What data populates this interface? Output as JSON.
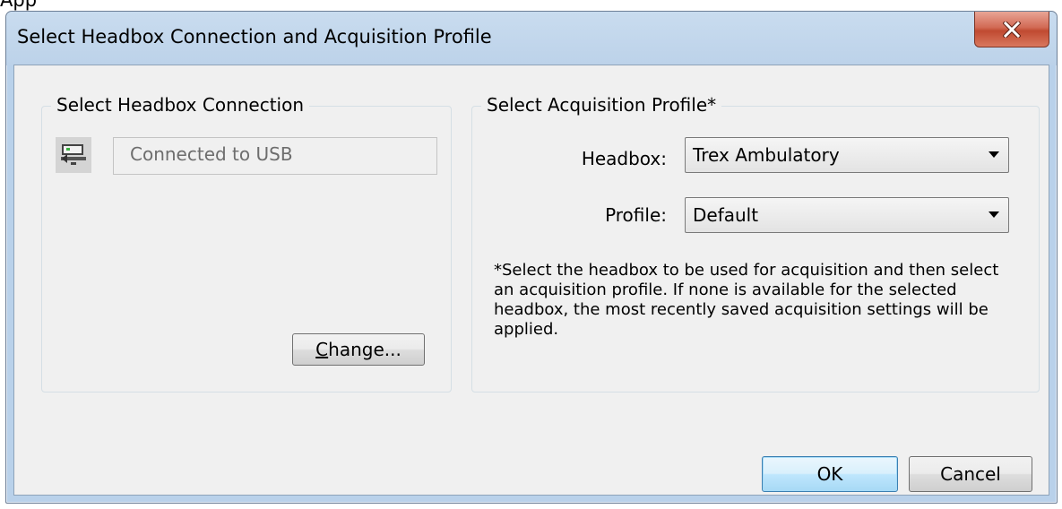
{
  "background_text": "App",
  "window": {
    "title": "Select Headbox Connection and Acquisition Profile",
    "close_icon": "close-icon"
  },
  "connection_group": {
    "legend": "Select Headbox Connection",
    "icon": "usb-connection-icon",
    "status_value": "Connected to USB",
    "change_button": {
      "prefix": "",
      "mnemonic": "C",
      "rest": "hange..."
    }
  },
  "profile_group": {
    "legend": "Select Acquisition Profile*",
    "headbox_label": "Headbox:",
    "headbox_value": "Trex Ambulatory",
    "profile_label": "Profile:",
    "profile_value": "Default",
    "note": "*Select the headbox to be used for acquisition and then select an acquisition profile. If none is available for the selected headbox, the most recently saved acquisition settings will be applied."
  },
  "footer": {
    "ok_label": "OK",
    "cancel_label": "Cancel"
  }
}
